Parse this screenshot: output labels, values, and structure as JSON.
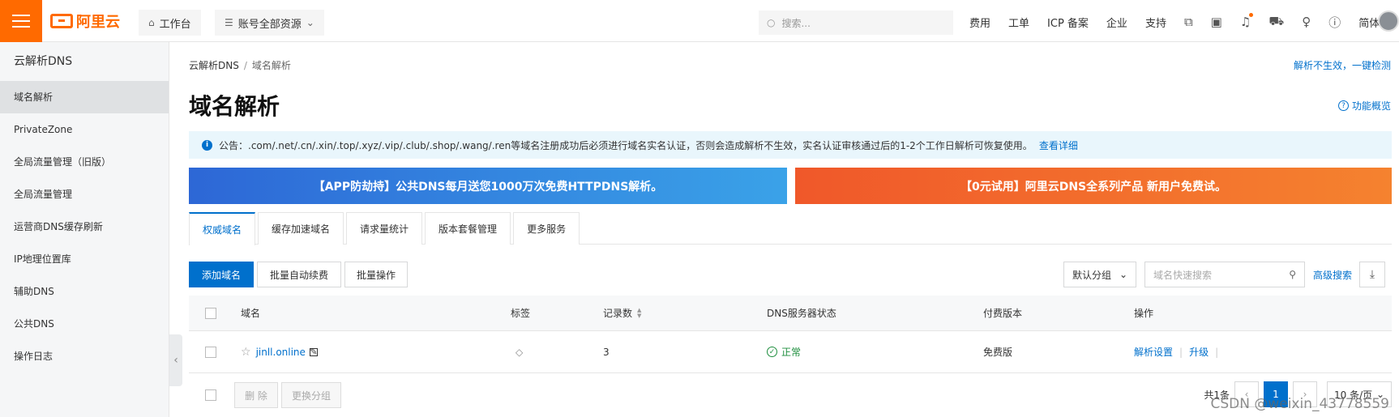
{
  "topbar": {
    "logo_text": "阿里云",
    "workbench_label": "工作台",
    "resources_label": "账号全部资源",
    "search_placeholder": "搜索...",
    "links": [
      "费用",
      "工单",
      "ICP 备案",
      "企业",
      "支持"
    ],
    "language_label": "简体"
  },
  "sidebar": {
    "title": "云解析DNS",
    "items": [
      {
        "label": "域名解析"
      },
      {
        "label": "PrivateZone"
      },
      {
        "label": "全局流量管理（旧版）"
      },
      {
        "label": "全局流量管理"
      },
      {
        "label": "运营商DNS缓存刷新"
      },
      {
        "label": "IP地理位置库"
      },
      {
        "label": "辅助DNS"
      },
      {
        "label": "公共DNS"
      },
      {
        "label": "操作日志"
      }
    ]
  },
  "breadcrumb": {
    "root": "云解析DNS",
    "current": "域名解析"
  },
  "check_link": "解析不生效，一键检测",
  "page_title": "域名解析",
  "overview_link": "功能概览",
  "notice": {
    "text": "公告：.com/.net/.cn/.xin/.top/.xyz/.vip/.club/.shop/.wang/.ren等域名注册成功后必须进行域名实名认证，否则会造成解析不生效，实名认证审核通过后的1-2个工作日解析可恢复使用。",
    "link": "查看详细"
  },
  "banners": {
    "left": "【APP防劫持】公共DNS每月送您1000万次免费HTTPDNS解析。",
    "right": "【0元试用】阿里云DNS全系列产品 新用户免费试。"
  },
  "tabs": [
    {
      "label": "权威域名"
    },
    {
      "label": "缓存加速域名"
    },
    {
      "label": "请求量统计"
    },
    {
      "label": "版本套餐管理"
    },
    {
      "label": "更多服务"
    }
  ],
  "toolbar": {
    "add_domain": "添加域名",
    "batch_renew": "批量自动续费",
    "batch_ops": "批量操作",
    "group_select": "默认分组",
    "quick_search_placeholder": "域名快速搜索",
    "advanced_search": "高级搜索"
  },
  "table": {
    "headers": {
      "domain": "域名",
      "tag": "标签",
      "records": "记录数",
      "dns_status": "DNS服务器状态",
      "edition": "付费版本",
      "actions": "操作"
    },
    "rows": [
      {
        "domain": "jinll.online",
        "records": "3",
        "dns_status": "正常",
        "edition": "免费版",
        "action_settings": "解析设置",
        "action_upgrade": "升级"
      }
    ]
  },
  "footer": {
    "delete": "删 除",
    "change_group": "更换分组",
    "total": "共1条",
    "current_page": "1",
    "page_size": "10 条/页"
  },
  "watermark": "CSDN @weixin_43778559",
  "colors": {
    "brand_orange": "#ff6a00",
    "primary_blue": "#0070cc",
    "success_green": "#1e8e3e"
  }
}
